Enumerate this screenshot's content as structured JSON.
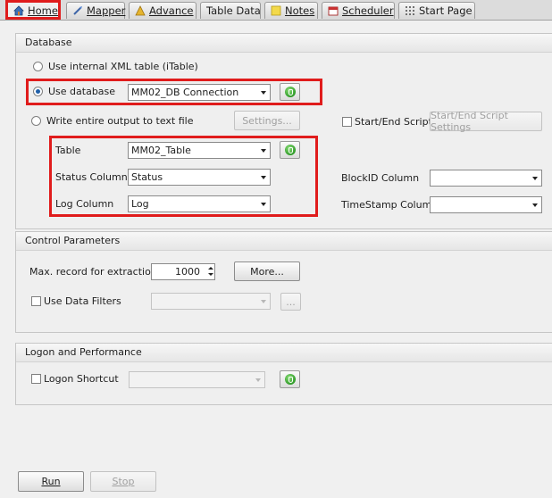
{
  "tabs": [
    {
      "label": "Home",
      "icon": "home-icon"
    },
    {
      "label": "Mapper",
      "icon": "mapper-icon"
    },
    {
      "label": "Advance",
      "icon": "advance-icon"
    },
    {
      "label": "Table Data",
      "icon": ""
    },
    {
      "label": "Notes",
      "icon": "notes-icon"
    },
    {
      "label": "Scheduler",
      "icon": "scheduler-icon"
    },
    {
      "label": "Start Page",
      "icon": "start-page-icon"
    }
  ],
  "database": {
    "title": "Database",
    "opt_xml": "Use internal XML table (iTable)",
    "opt_db": "Use database",
    "db_connection": "MM02_DB Connection",
    "opt_text": "Write entire output to text file",
    "settings_btn": "Settings...",
    "start_end_script": "Start/End Script",
    "start_end_settings_btn": "Start/End Script Settings",
    "table_label": "Table",
    "table_value": "MM02_Table",
    "status_label": "Status Column",
    "status_value": "Status",
    "log_label": "Log Column",
    "log_value": "Log",
    "blockid_label": "BlockID Column",
    "blockid_value": "",
    "timestamp_label": "TimeStamp Column",
    "timestamp_value": ""
  },
  "control": {
    "title": "Control Parameters",
    "max_label": "Max. record for extraction",
    "max_value": "1000",
    "more_btn": "More...",
    "filters_label": "Use Data Filters",
    "filters_value": "",
    "filters_btn": "..."
  },
  "logon": {
    "title": "Logon and Performance",
    "shortcut_label": "Logon Shortcut",
    "shortcut_value": ""
  },
  "footer": {
    "run_btn": "Run",
    "stop_btn": "Stop"
  },
  "colors": {
    "highlight": "#e01c1c",
    "go_green": "#2e9a27"
  }
}
